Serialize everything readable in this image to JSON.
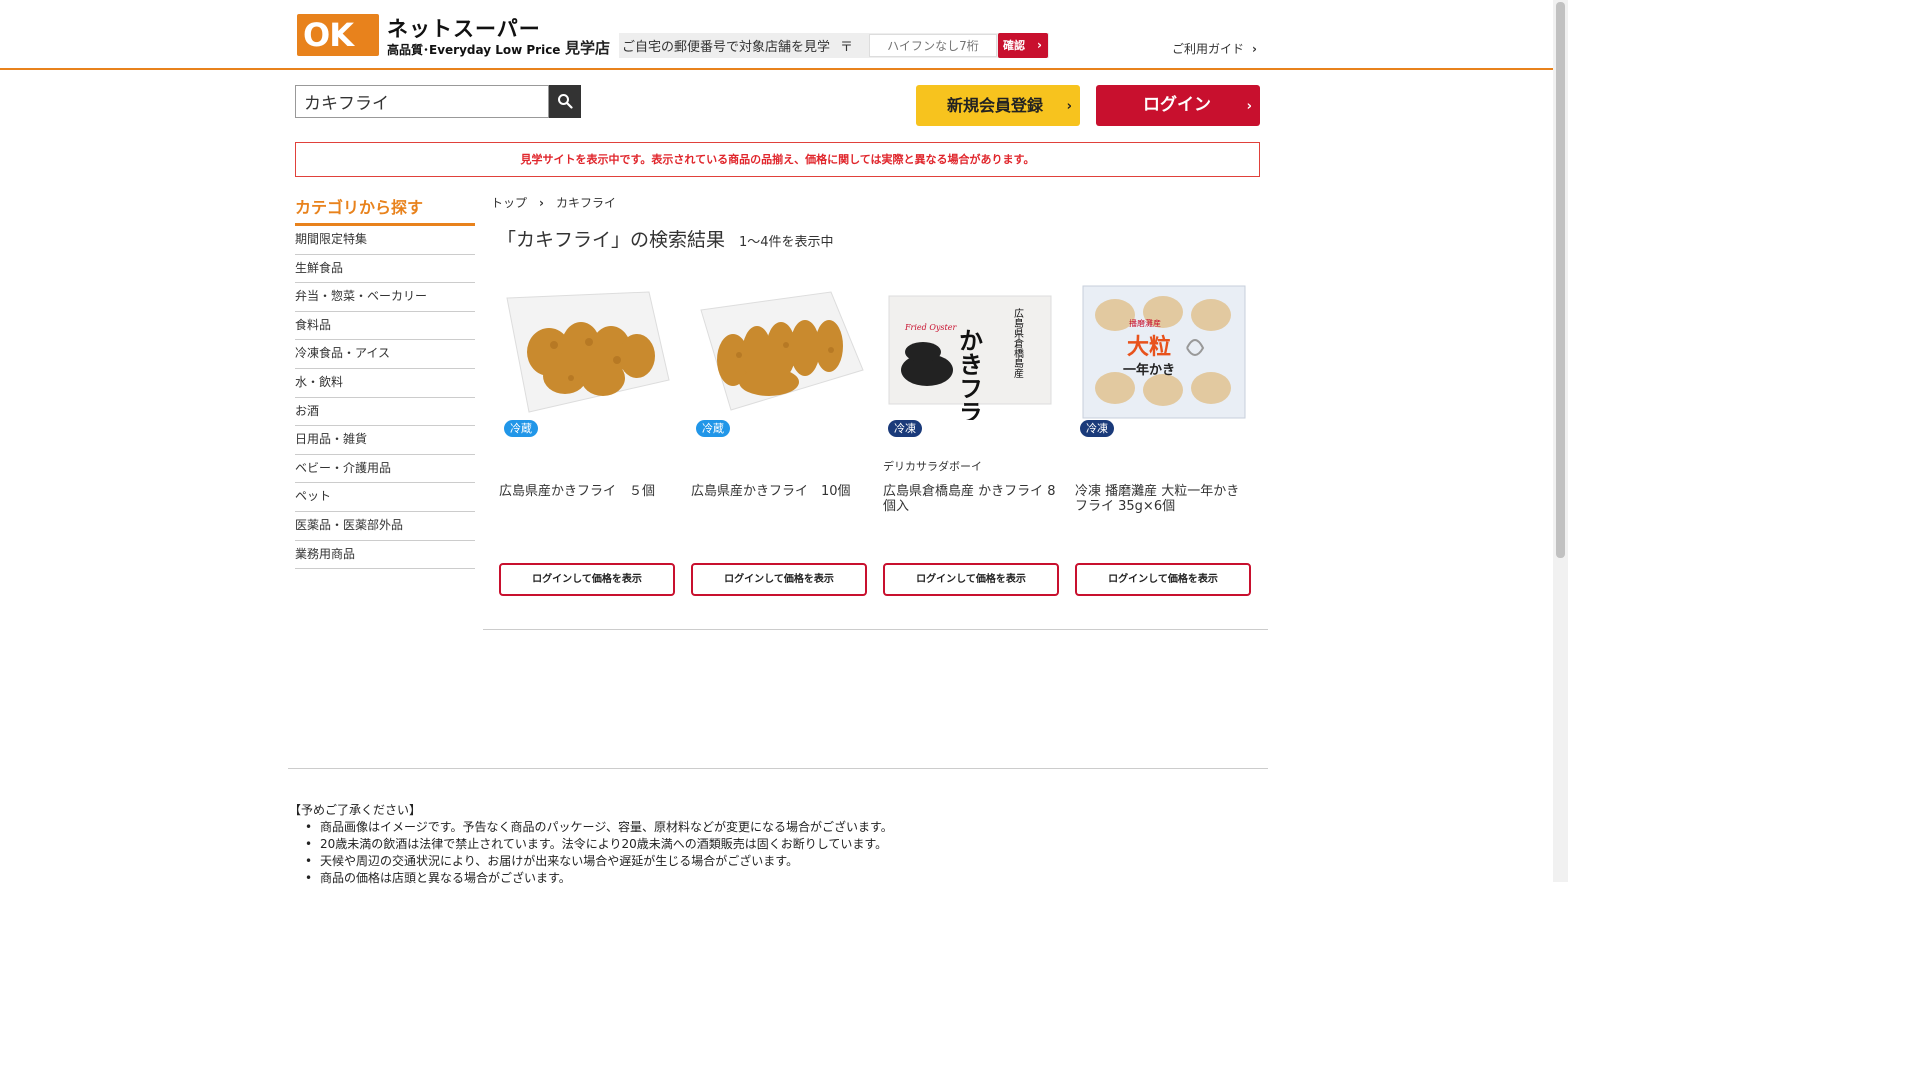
{
  "header": {
    "logo_mark": "OK",
    "logo_name": "ネットスーパー",
    "logo_tagline": "高品質･Everyday Low Price",
    "store_label": "見学店",
    "zip_prompt": "ご自宅の郵便番号で対象店舗を見学",
    "zip_mark": "〒",
    "zip_placeholder": "ハイフンなし7桁",
    "zip_button": "確認",
    "guide_link": "ご利用ガイド"
  },
  "search": {
    "value": "カキフライ"
  },
  "actions": {
    "register": "新規会員登録",
    "login": "ログイン"
  },
  "notice": "見学サイトを表示中です。表示されている商品の品揃え、価格に関しては実際と異なる場合があります。",
  "sidebar": {
    "title": "カテゴリから探す",
    "items": [
      {
        "label": "期間限定特集"
      },
      {
        "label": "生鮮食品"
      },
      {
        "label": "弁当・惣菜・ベーカリー"
      },
      {
        "label": "食料品"
      },
      {
        "label": "冷凍食品・アイス"
      },
      {
        "label": "水・飲料"
      },
      {
        "label": "お酒"
      },
      {
        "label": "日用品・雑貨"
      },
      {
        "label": "ベビー・介護用品"
      },
      {
        "label": "ペット"
      },
      {
        "label": "医薬品・医薬部外品"
      },
      {
        "label": "業務用商品"
      }
    ]
  },
  "breadcrumb": {
    "home": "トップ",
    "current": "カキフライ"
  },
  "results": {
    "title": "「カキフライ」の検索結果",
    "count": "1～4件を表示中"
  },
  "products": [
    {
      "badge": "冷蔵",
      "maker": "",
      "name": "広島県産かきフライ　５個",
      "button": "ログインして価格を表示"
    },
    {
      "badge": "冷蔵",
      "maker": "",
      "name": "広島県産かきフライ　10個",
      "button": "ログインして価格を表示"
    },
    {
      "badge": "冷凍",
      "maker": "デリカサラダボーイ",
      "name": "広島県倉橋島産 かきフライ 8個入",
      "button": "ログインして価格を表示",
      "package_text": "かきフライ",
      "package_sub": "Fried Oyster",
      "package_origin": "広島県倉橋島産"
    },
    {
      "badge": "冷凍",
      "maker": "",
      "name": "冷凍 播磨灘産 大粒一年かきフライ 35g×6個",
      "button": "ログインして価格を表示",
      "package_text": "大粒",
      "package_sub": "一年かき",
      "package_origin": "播磨灘産"
    }
  ],
  "footer": {
    "title": "【予めご了承ください】",
    "notes": [
      "商品画像はイメージです。予告なく商品のパッケージ、容量、原材料などが変更になる場合がございます。",
      "20歳未満の飲酒は法律で禁止されています。法令により20歳未満への酒類販売は固くお断りしています。",
      "天候や周辺の交通状況により、お届けが出来ない場合や遅延が生じる場合がございます。",
      "商品の価格は店頭と異なる場合がございます。"
    ]
  },
  "colors": {
    "brand_orange": "#e8821c",
    "brand_red": "#c8102e",
    "register_yellow": "#f7c31e",
    "chilled_blue": "#2196e8",
    "frozen_navy": "#1a3a7a"
  }
}
